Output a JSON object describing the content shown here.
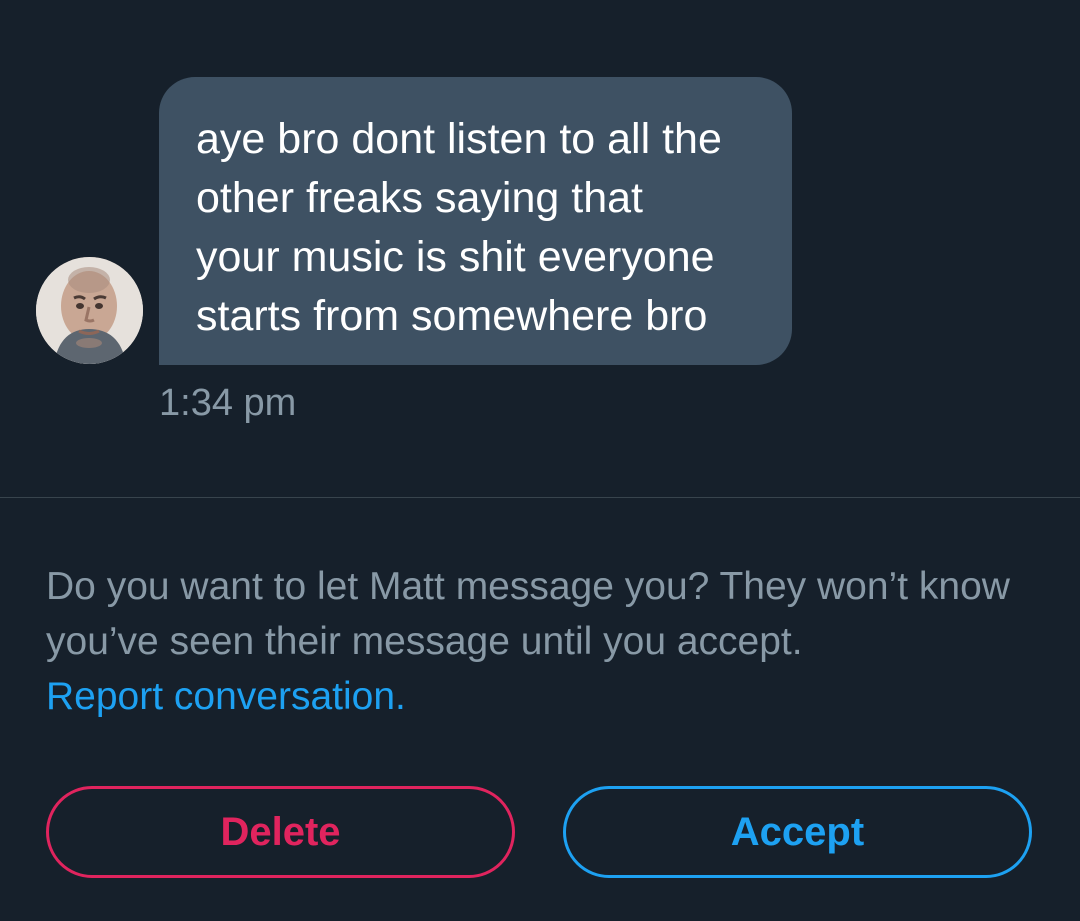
{
  "conversation": {
    "message": {
      "text": "aye bro dont listen to all the\nother freaks saying that\nyour music is  shit everyone\nstarts from somewhere bro",
      "time": "1:34 pm"
    },
    "avatar_icon": "profile-photo-icon"
  },
  "request": {
    "prompt": "Do you want to let Matt message you? They won’t know you’ve seen their message until you accept.",
    "report_link": "Report conversation.",
    "delete_label": "Delete",
    "accept_label": "Accept"
  },
  "colors": {
    "background": "#16202b",
    "bubble": "#3e5163",
    "muted_text": "#8899a6",
    "link": "#1da1f2",
    "delete": "#e0245e",
    "accept": "#1da1f2"
  }
}
